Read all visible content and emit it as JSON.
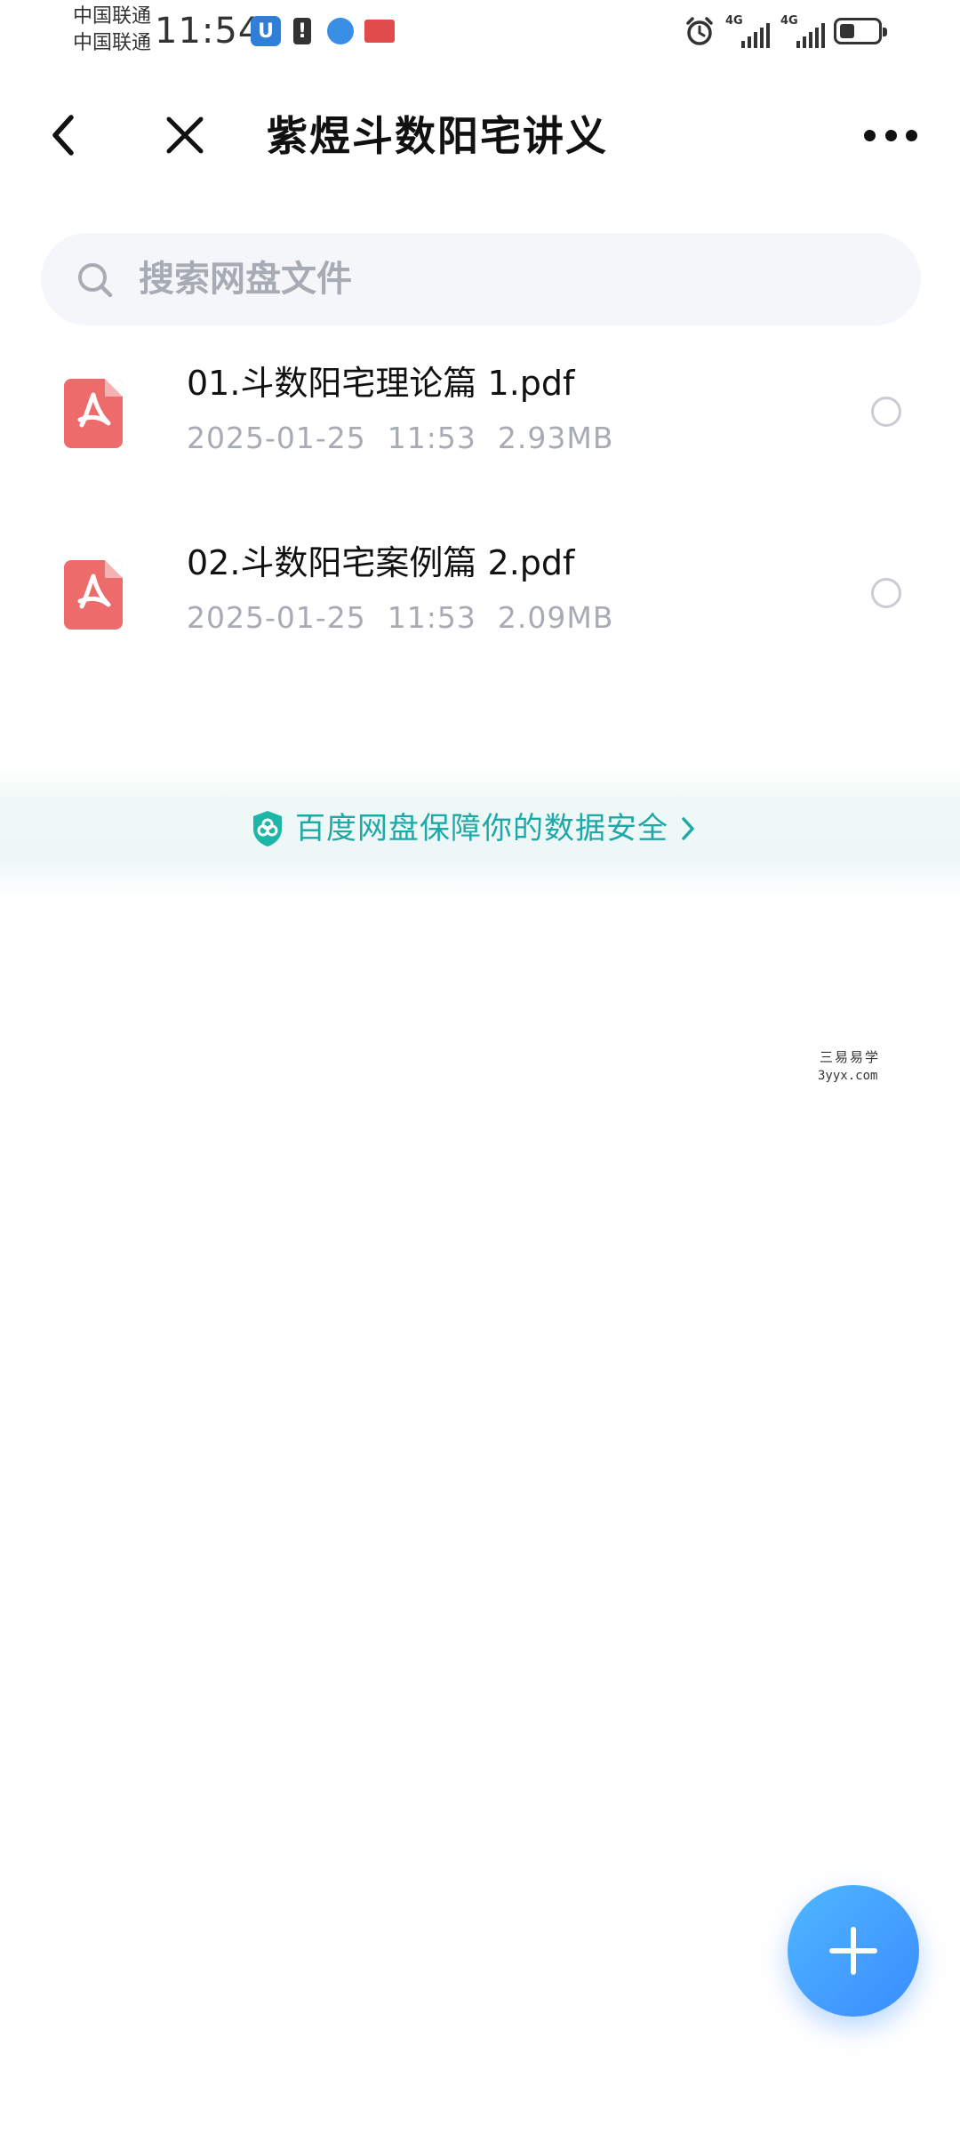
{
  "status_bar": {
    "carrier_1": "中国联通",
    "carrier_2": "中国联通",
    "time": "11:54",
    "app_icon": "U",
    "notice_icon": "!",
    "network_1": "4G",
    "network_2": "4G",
    "icons": [
      "app-u-icon",
      "notice-icon",
      "globe-icon",
      "book-icon",
      "alarm-icon",
      "signal-icon",
      "battery-icon"
    ]
  },
  "header": {
    "title": "紫煜斗数阳宅讲义",
    "icons": [
      "back-icon",
      "close-icon",
      "more-icon"
    ]
  },
  "search": {
    "placeholder": "搜索网盘文件",
    "value": ""
  },
  "files": [
    {
      "name": "01.斗数阳宅理论篇 1.pdf",
      "date": "2025-01-25",
      "time": "11:53",
      "size": "2.93MB",
      "icon": "pdf-icon",
      "selected": false
    },
    {
      "name": "02.斗数阳宅案例篇 2.pdf",
      "date": "2025-01-25",
      "time": "11:53",
      "size": "2.09MB",
      "icon": "pdf-icon",
      "selected": false
    }
  ],
  "banner": {
    "text": "百度网盘保障你的数据安全",
    "icon": "shield-icon"
  },
  "watermark": {
    "line1": "三易易学",
    "line2": "3yyx.com"
  },
  "fab": {
    "icon": "plus-icon"
  },
  "colors": {
    "accent": "#3a8cff",
    "banner_text": "#1fa8a8",
    "pdf_red": "#ee6b6b",
    "meta_gray": "#a7abb3"
  }
}
